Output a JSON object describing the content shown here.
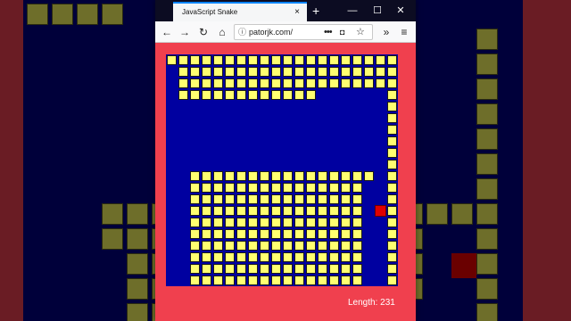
{
  "browser": {
    "tab_title": "JavaScript Snake",
    "tab_close": "×",
    "new_tab": "+",
    "window_minimize": "—",
    "window_maximize": "☐",
    "window_close": "✕",
    "url": "patorjk.com/",
    "page_actions": "•••",
    "back_icon": "←",
    "forward_icon": "→",
    "reload_icon": "↻",
    "home_icon": "⌂",
    "overflow_icon": "»",
    "menu_icon": "≡",
    "info_icon": "ⓘ",
    "pocket_icon": "◘",
    "star_icon": "☆"
  },
  "game": {
    "length_label": "Length: 231",
    "board_color": "#0000a0",
    "snake_color": "#ffff70",
    "food_color": "#e00000",
    "page_background": "#f0404e"
  }
}
